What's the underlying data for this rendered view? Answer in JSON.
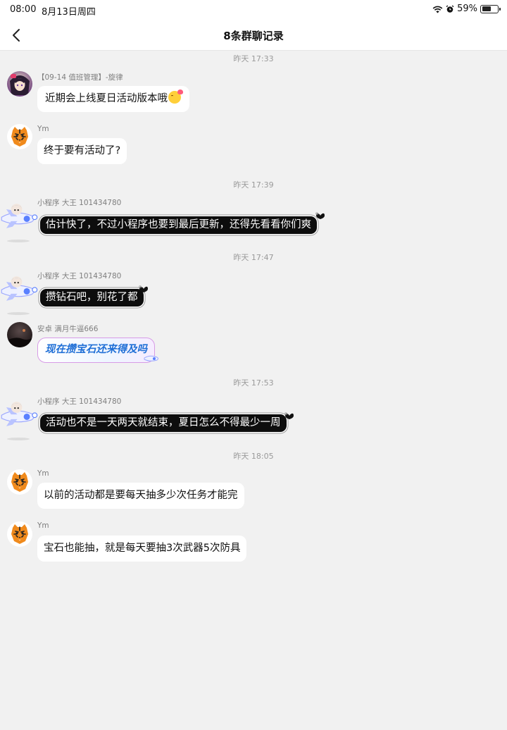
{
  "status": {
    "time": "08:00",
    "date": "8月13日周四",
    "battery": "59%",
    "battery_level": 0.59
  },
  "header": {
    "title": "8条群聊记录",
    "back_icon": "chevron-left-icon"
  },
  "messages": [
    {
      "time": "昨天 17:33",
      "sender": "【09-14 值班管理】-旋律",
      "text": "近期会上线夏日活动版本哦",
      "emoji": "smiling-face-hearts-icon"
    },
    {
      "sender": "Ym",
      "text": "终于要有活动了?"
    },
    {
      "time": "昨天 17:39",
      "sender": "小程序 大王 101434780",
      "text": "估计快了，不过小程序也要到最后更新，还得先看看你们爽"
    },
    {
      "time": "昨天 17:47",
      "sender": "小程序 大王 101434780",
      "text": "攒钻石吧，别花了都"
    },
    {
      "sender": "安卓   满月牛逼666",
      "text": "现在攒宝石还来得及吗"
    },
    {
      "time": "昨天 17:53",
      "sender": "小程序 大王 101434780",
      "text": "活动也不是一天两天就结束，夏日怎么不得最少一周"
    },
    {
      "time": "昨天 18:05",
      "sender": "Ym",
      "text": "以前的活动都是要每天抽多少次任务才能完"
    },
    {
      "sender": "Ym",
      "text": "宝石也能抽，就是每天要抽3次武器5次防具"
    }
  ]
}
